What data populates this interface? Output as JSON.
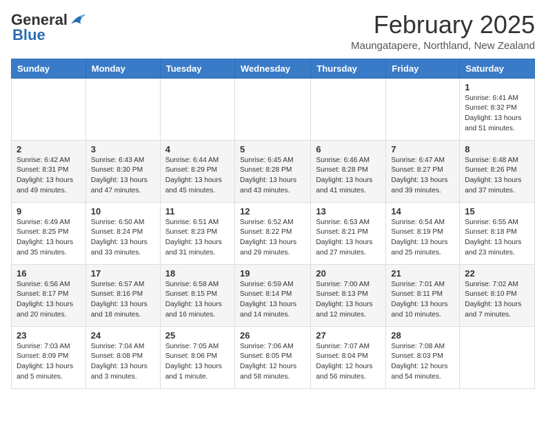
{
  "logo": {
    "general": "General",
    "blue": "Blue"
  },
  "header": {
    "title": "February 2025",
    "subtitle": "Maungatapere, Northland, New Zealand"
  },
  "weekdays": [
    "Sunday",
    "Monday",
    "Tuesday",
    "Wednesday",
    "Thursday",
    "Friday",
    "Saturday"
  ],
  "weeks": [
    [
      {
        "day": "",
        "info": ""
      },
      {
        "day": "",
        "info": ""
      },
      {
        "day": "",
        "info": ""
      },
      {
        "day": "",
        "info": ""
      },
      {
        "day": "",
        "info": ""
      },
      {
        "day": "",
        "info": ""
      },
      {
        "day": "1",
        "info": "Sunrise: 6:41 AM\nSunset: 8:32 PM\nDaylight: 13 hours\nand 51 minutes."
      }
    ],
    [
      {
        "day": "2",
        "info": "Sunrise: 6:42 AM\nSunset: 8:31 PM\nDaylight: 13 hours\nand 49 minutes."
      },
      {
        "day": "3",
        "info": "Sunrise: 6:43 AM\nSunset: 8:30 PM\nDaylight: 13 hours\nand 47 minutes."
      },
      {
        "day": "4",
        "info": "Sunrise: 6:44 AM\nSunset: 8:29 PM\nDaylight: 13 hours\nand 45 minutes."
      },
      {
        "day": "5",
        "info": "Sunrise: 6:45 AM\nSunset: 8:28 PM\nDaylight: 13 hours\nand 43 minutes."
      },
      {
        "day": "6",
        "info": "Sunrise: 6:46 AM\nSunset: 8:28 PM\nDaylight: 13 hours\nand 41 minutes."
      },
      {
        "day": "7",
        "info": "Sunrise: 6:47 AM\nSunset: 8:27 PM\nDaylight: 13 hours\nand 39 minutes."
      },
      {
        "day": "8",
        "info": "Sunrise: 6:48 AM\nSunset: 8:26 PM\nDaylight: 13 hours\nand 37 minutes."
      }
    ],
    [
      {
        "day": "9",
        "info": "Sunrise: 6:49 AM\nSunset: 8:25 PM\nDaylight: 13 hours\nand 35 minutes."
      },
      {
        "day": "10",
        "info": "Sunrise: 6:50 AM\nSunset: 8:24 PM\nDaylight: 13 hours\nand 33 minutes."
      },
      {
        "day": "11",
        "info": "Sunrise: 6:51 AM\nSunset: 8:23 PM\nDaylight: 13 hours\nand 31 minutes."
      },
      {
        "day": "12",
        "info": "Sunrise: 6:52 AM\nSunset: 8:22 PM\nDaylight: 13 hours\nand 29 minutes."
      },
      {
        "day": "13",
        "info": "Sunrise: 6:53 AM\nSunset: 8:21 PM\nDaylight: 13 hours\nand 27 minutes."
      },
      {
        "day": "14",
        "info": "Sunrise: 6:54 AM\nSunset: 8:19 PM\nDaylight: 13 hours\nand 25 minutes."
      },
      {
        "day": "15",
        "info": "Sunrise: 6:55 AM\nSunset: 8:18 PM\nDaylight: 13 hours\nand 23 minutes."
      }
    ],
    [
      {
        "day": "16",
        "info": "Sunrise: 6:56 AM\nSunset: 8:17 PM\nDaylight: 13 hours\nand 20 minutes."
      },
      {
        "day": "17",
        "info": "Sunrise: 6:57 AM\nSunset: 8:16 PM\nDaylight: 13 hours\nand 18 minutes."
      },
      {
        "day": "18",
        "info": "Sunrise: 6:58 AM\nSunset: 8:15 PM\nDaylight: 13 hours\nand 16 minutes."
      },
      {
        "day": "19",
        "info": "Sunrise: 6:59 AM\nSunset: 8:14 PM\nDaylight: 13 hours\nand 14 minutes."
      },
      {
        "day": "20",
        "info": "Sunrise: 7:00 AM\nSunset: 8:13 PM\nDaylight: 13 hours\nand 12 minutes."
      },
      {
        "day": "21",
        "info": "Sunrise: 7:01 AM\nSunset: 8:11 PM\nDaylight: 13 hours\nand 10 minutes."
      },
      {
        "day": "22",
        "info": "Sunrise: 7:02 AM\nSunset: 8:10 PM\nDaylight: 13 hours\nand 7 minutes."
      }
    ],
    [
      {
        "day": "23",
        "info": "Sunrise: 7:03 AM\nSunset: 8:09 PM\nDaylight: 13 hours\nand 5 minutes."
      },
      {
        "day": "24",
        "info": "Sunrise: 7:04 AM\nSunset: 8:08 PM\nDaylight: 13 hours\nand 3 minutes."
      },
      {
        "day": "25",
        "info": "Sunrise: 7:05 AM\nSunset: 8:06 PM\nDaylight: 13 hours\nand 1 minute."
      },
      {
        "day": "26",
        "info": "Sunrise: 7:06 AM\nSunset: 8:05 PM\nDaylight: 12 hours\nand 58 minutes."
      },
      {
        "day": "27",
        "info": "Sunrise: 7:07 AM\nSunset: 8:04 PM\nDaylight: 12 hours\nand 56 minutes."
      },
      {
        "day": "28",
        "info": "Sunrise: 7:08 AM\nSunset: 8:03 PM\nDaylight: 12 hours\nand 54 minutes."
      },
      {
        "day": "",
        "info": ""
      }
    ]
  ]
}
